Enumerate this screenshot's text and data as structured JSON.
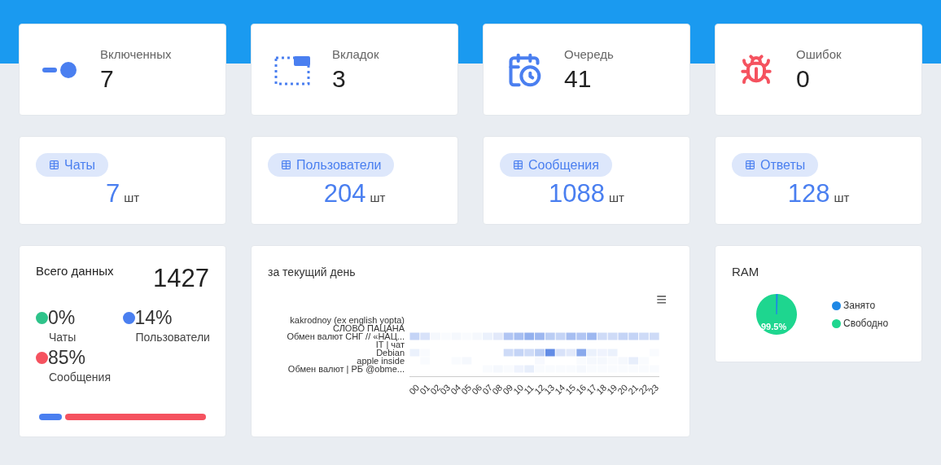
{
  "counters": [
    {
      "kind": "toggle",
      "label": "Включенных",
      "value": "7"
    },
    {
      "kind": "tabs",
      "label": "Вкладок",
      "value": "3"
    },
    {
      "kind": "queue",
      "label": "Очередь",
      "value": "41"
    },
    {
      "kind": "errors",
      "label": "Ошибок",
      "value": "0"
    }
  ],
  "totals": [
    {
      "label": "Чаты",
      "value": "7",
      "unit": "шт"
    },
    {
      "label": "Пользователи",
      "value": "204",
      "unit": "шт"
    },
    {
      "label": "Сообщения",
      "value": "1088",
      "unit": "шт"
    },
    {
      "label": "Ответы",
      "value": "128",
      "unit": "шт"
    }
  ],
  "data_card": {
    "title": "Всего данных",
    "total": "1427",
    "shares": [
      {
        "percent": "0%",
        "label": "Чаты",
        "color": "#2ec38a"
      },
      {
        "percent": "14%",
        "label": "Пользователи",
        "color": "#4a7ff0"
      },
      {
        "percent": "85%",
        "label": "Сообщения",
        "color": "#f5525f"
      }
    ]
  },
  "heatmap": {
    "title": "за текущий день",
    "menu": "≡",
    "hours": [
      "00",
      "01",
      "02",
      "03",
      "04",
      "05",
      "06",
      "07",
      "08",
      "09",
      "10",
      "11",
      "12",
      "13",
      "14",
      "15",
      "16",
      "17",
      "18",
      "19",
      "20",
      "21",
      "22",
      "23"
    ],
    "rows": [
      {
        "label": "kakrodnoy (ex english yopta)"
      },
      {
        "label": "СЛОВО ПАЦАНА"
      },
      {
        "label": "Обмен валют СНГ // «НАЦ..."
      },
      {
        "label": "IT | чат"
      },
      {
        "label": "Debian"
      },
      {
        "label": "apple  inside"
      },
      {
        "label": "Обмен валют | РБ @obme..."
      }
    ]
  },
  "ram": {
    "title": "RAM",
    "chart_data": {
      "type": "pie",
      "categories": [
        "Занято",
        "Свободно"
      ],
      "values": [
        0.5,
        99.5
      ],
      "colors": [
        "#1e88e5",
        "#1ed68f"
      ],
      "legend": true,
      "annotations": [
        {
          "text": "99.5%"
        }
      ]
    }
  }
}
